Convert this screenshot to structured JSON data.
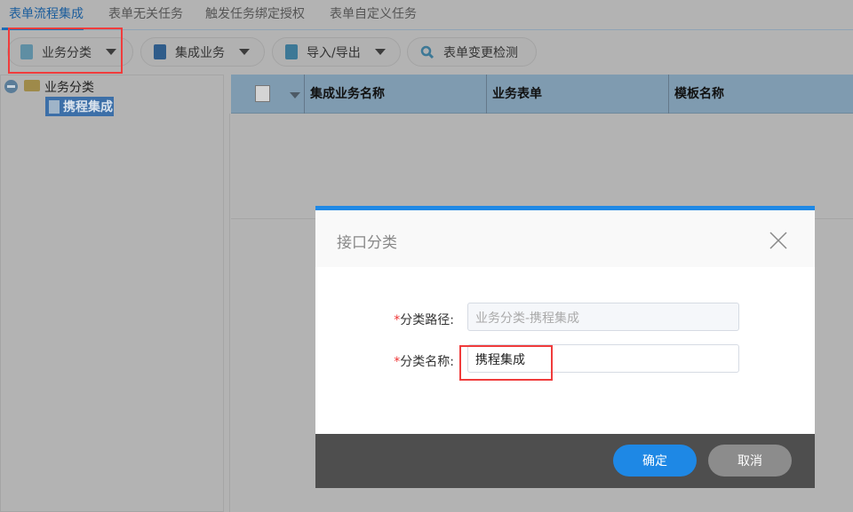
{
  "tabs": [
    {
      "label": "表单流程集成",
      "active": true
    },
    {
      "label": "表单无关任务"
    },
    {
      "label": "触发任务绑定授权"
    },
    {
      "label": "表单自定义任务"
    }
  ],
  "toolbar": {
    "category": "业务分类",
    "integration": "集成业务",
    "import_export": "导入/导出",
    "change_check": "表单变更检测"
  },
  "tree": {
    "root": "业务分类",
    "child": "携程集成"
  },
  "grid": {
    "columns": [
      "集成业务名称",
      "业务表单",
      "模板名称"
    ]
  },
  "dialog": {
    "title": "接口分类",
    "path_label": "分类路径:",
    "path_value": "业务分类-携程集成",
    "name_label": "分类名称:",
    "name_value": "携程集成",
    "required_mark": "*",
    "ok": "确定",
    "cancel": "取消"
  },
  "colors": {
    "accent": "#1e88e5",
    "highlight": "#f03c3c"
  }
}
